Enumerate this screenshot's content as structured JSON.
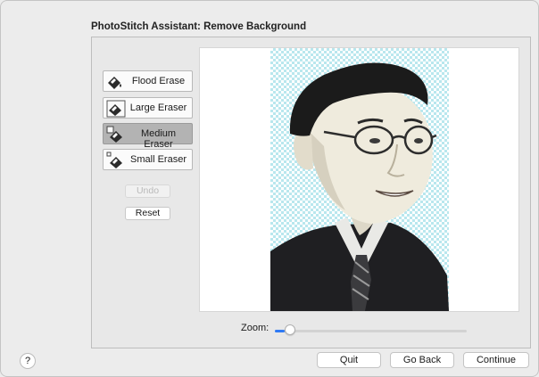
{
  "dialog": {
    "title": "PhotoStitch Assistant: Remove Background"
  },
  "tools": [
    {
      "label": "Flood Erase",
      "icon": "flood-eraser-icon",
      "selected": false
    },
    {
      "label": "Large Eraser",
      "icon": "large-eraser-icon",
      "selected": false
    },
    {
      "label": "Medium Eraser",
      "icon": "medium-eraser-icon",
      "selected": true
    },
    {
      "label": "Small Eraser",
      "icon": "small-eraser-icon",
      "selected": false
    }
  ],
  "actions": {
    "undo_label": "Undo",
    "undo_enabled": false,
    "reset_label": "Reset"
  },
  "zoom": {
    "label": "Zoom:",
    "value": 0.05
  },
  "footer": {
    "help_label": "?",
    "quit_label": "Quit",
    "back_label": "Go Back",
    "continue_label": "Continue"
  },
  "colors": {
    "accent": "#2f7af5",
    "transparency_checker": "#b9e7ee"
  }
}
